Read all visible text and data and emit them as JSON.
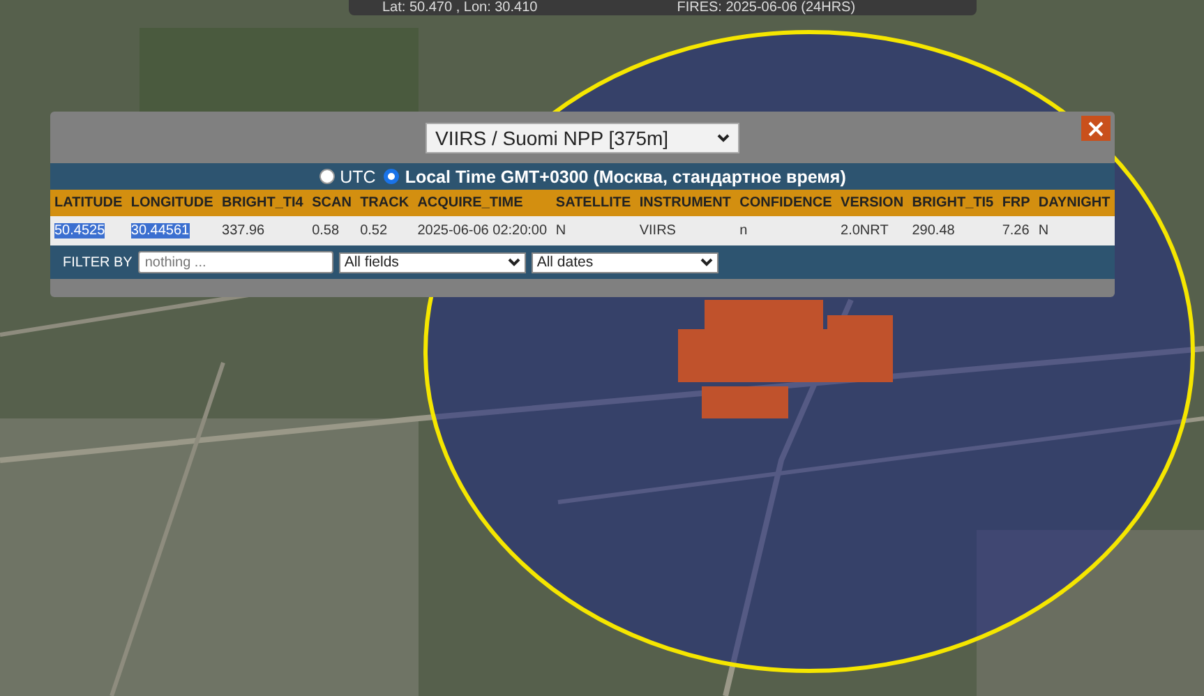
{
  "status_bar": {
    "coordinates": "Lat: 50.470 , Lon: 30.410",
    "fires": "FIRES: 2025-06-06 (24HRS)"
  },
  "popup": {
    "source_select": "VIIRS / Suomi NPP [375m]",
    "time_options": [
      {
        "label": "UTC",
        "selected": false
      },
      {
        "label": "Local Time GMT+0300 (Москва, стандартное время)",
        "selected": true
      }
    ],
    "table": {
      "columns": [
        "LATITUDE",
        "LONGITUDE",
        "BRIGHT_TI4",
        "SCAN",
        "TRACK",
        "ACQUIRE_TIME",
        "SATELLITE",
        "INSTRUMENT",
        "CONFIDENCE",
        "VERSION",
        "BRIGHT_TI5",
        "FRP",
        "DAYNIGHT"
      ],
      "rows": [
        {
          "cells": [
            {
              "text": "50.4525",
              "highlighted": true
            },
            {
              "text": "30.44561",
              "highlighted": true
            },
            {
              "text": "337.96",
              "highlighted": false
            },
            {
              "text": "0.58",
              "highlighted": false
            },
            {
              "text": "0.52",
              "highlighted": false
            },
            {
              "text": "2025-06-06 02:20:00",
              "highlighted": false
            },
            {
              "text": "N",
              "highlighted": false
            },
            {
              "text": "VIIRS",
              "highlighted": false
            },
            {
              "text": "n",
              "highlighted": false
            },
            {
              "text": "2.0NRT",
              "highlighted": false
            },
            {
              "text": "290.48",
              "highlighted": false
            },
            {
              "text": "7.26",
              "highlighted": false
            },
            {
              "text": "N",
              "highlighted": false
            }
          ]
        }
      ]
    },
    "filter": {
      "label": "FILTER BY",
      "placeholder": "nothing ...",
      "field_select": "All fields",
      "date_select": "All dates"
    }
  }
}
